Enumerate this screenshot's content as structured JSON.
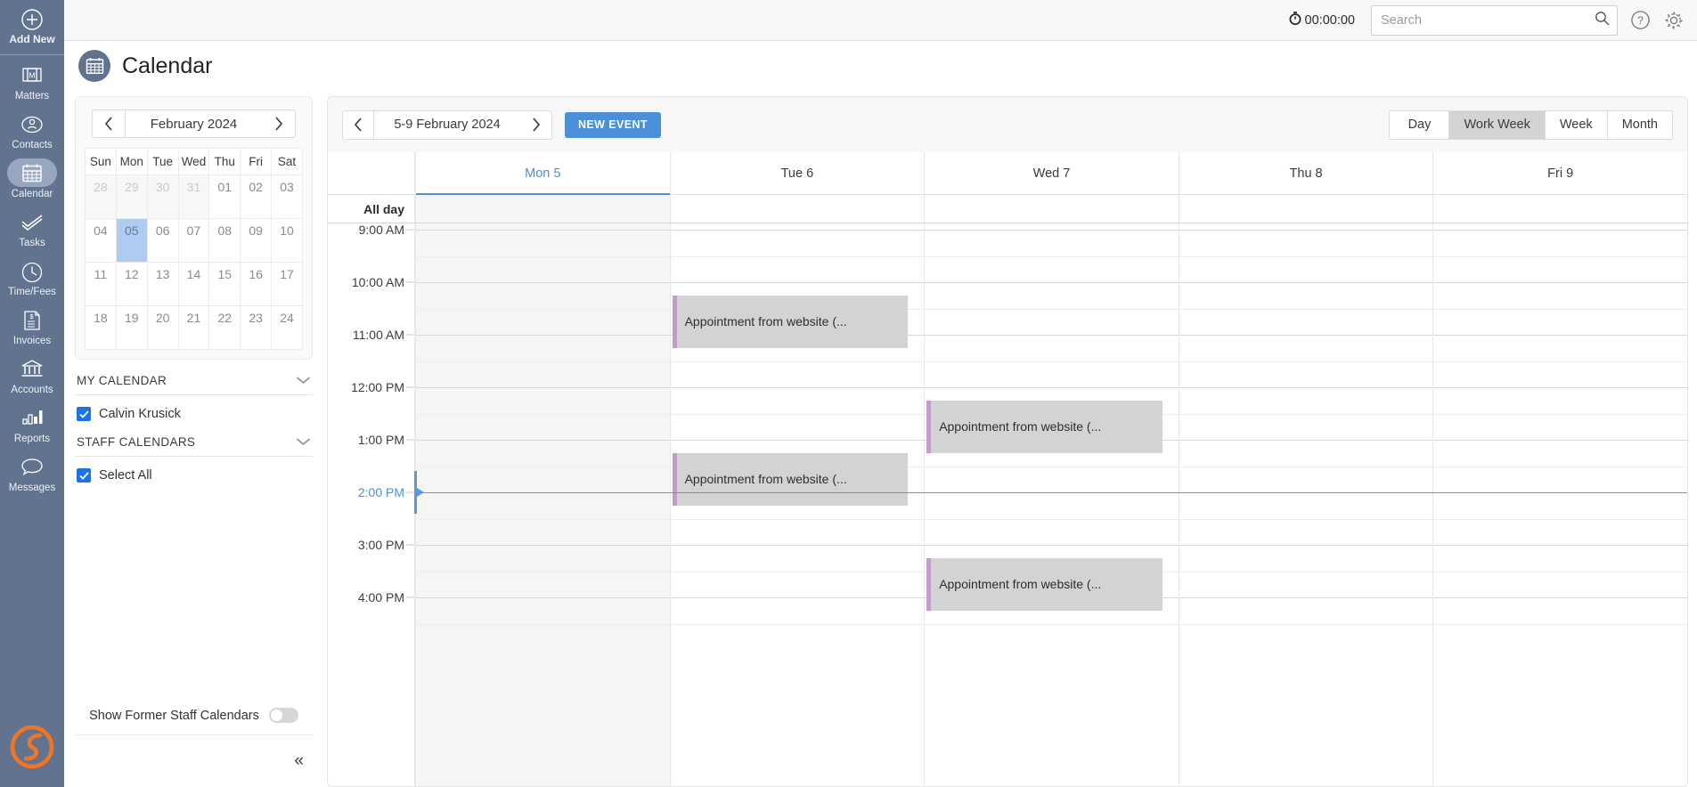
{
  "leftnav": {
    "add_new": {
      "label": "Add New",
      "icon": "plus-circle-icon"
    },
    "items": [
      {
        "label": "Matters",
        "icon": "matters-icon",
        "active": false
      },
      {
        "label": "Contacts",
        "icon": "contacts-icon",
        "active": false
      },
      {
        "label": "Calendar",
        "icon": "calendar-icon",
        "active": true
      },
      {
        "label": "Tasks",
        "icon": "tasks-icon",
        "active": false
      },
      {
        "label": "Time/Fees",
        "icon": "clock-icon",
        "active": false
      },
      {
        "label": "Invoices",
        "icon": "invoice-icon",
        "active": false
      },
      {
        "label": "Accounts",
        "icon": "bank-icon",
        "active": false
      },
      {
        "label": "Reports",
        "icon": "bar-chart-icon",
        "active": false
      },
      {
        "label": "Messages",
        "icon": "chat-icon",
        "active": false
      }
    ],
    "logo": "smokeball-s-logo",
    "bg_color": "#61738f",
    "active_pill_color": "#98a7bf",
    "logo_color": "#ef7622"
  },
  "topbar": {
    "timer_value": "00:00:00",
    "timer_icon": "stopwatch-icon",
    "search_placeholder": "Search",
    "search_value": "",
    "search_icon": "search-icon",
    "help_icon": "help-circle-icon",
    "settings_icon": "gear-icon"
  },
  "page": {
    "title": "Calendar",
    "icon": "calendar-badge-icon"
  },
  "minicalendar": {
    "prev_icon": "chevron-left-icon",
    "next_icon": "chevron-right-icon",
    "month_label": "February 2024",
    "weekdays": [
      "Sun",
      "Mon",
      "Tue",
      "Wed",
      "Thu",
      "Fri",
      "Sat"
    ],
    "weeks": [
      [
        {
          "d": "28",
          "out": true
        },
        {
          "d": "29",
          "out": true
        },
        {
          "d": "30",
          "out": true
        },
        {
          "d": "31",
          "out": true
        },
        {
          "d": "01",
          "out": false
        },
        {
          "d": "02",
          "out": false
        },
        {
          "d": "03",
          "out": false
        }
      ],
      [
        {
          "d": "04",
          "out": false
        },
        {
          "d": "05",
          "out": false,
          "selected": true
        },
        {
          "d": "06",
          "out": false
        },
        {
          "d": "07",
          "out": false
        },
        {
          "d": "08",
          "out": false
        },
        {
          "d": "09",
          "out": false
        },
        {
          "d": "10",
          "out": false
        }
      ],
      [
        {
          "d": "11",
          "out": false
        },
        {
          "d": "12",
          "out": false
        },
        {
          "d": "13",
          "out": false
        },
        {
          "d": "14",
          "out": false
        },
        {
          "d": "15",
          "out": false
        },
        {
          "d": "16",
          "out": false
        },
        {
          "d": "17",
          "out": false
        }
      ],
      [
        {
          "d": "18",
          "out": false
        },
        {
          "d": "19",
          "out": false
        },
        {
          "d": "20",
          "out": false
        },
        {
          "d": "21",
          "out": false
        },
        {
          "d": "22",
          "out": false
        },
        {
          "d": "23",
          "out": false
        },
        {
          "d": "24",
          "out": false
        }
      ]
    ],
    "selected_bg": "#aecbf2"
  },
  "calendar_list": {
    "my_calendar": {
      "header": "MY CALENDAR",
      "collapse_icon": "chevron-down-icon",
      "entries": [
        {
          "label": "Calvin Krusick",
          "checked": true
        }
      ]
    },
    "staff_calendars": {
      "header": "STAFF CALENDARS",
      "collapse_icon": "chevron-down-icon",
      "entries": [
        {
          "label": "Select All",
          "checked": true
        }
      ]
    },
    "former_toggle": {
      "label": "Show Former Staff Calendars",
      "on": false
    },
    "collapse_panel": {
      "icon": "double-chevron-left-icon",
      "glyph": "«"
    },
    "checkbox_color": "#1a73e8"
  },
  "toolbar": {
    "prev_icon": "chevron-left-icon",
    "next_icon": "chevron-right-icon",
    "range_label": "5-9 February 2024",
    "new_event_label": "NEW EVENT",
    "new_event_color": "#4a90d9",
    "views": [
      {
        "label": "Day",
        "active": false
      },
      {
        "label": "Work Week",
        "active": true
      },
      {
        "label": "Week",
        "active": false
      },
      {
        "label": "Month",
        "active": false
      }
    ]
  },
  "grid": {
    "all_day_label": "All day",
    "days": [
      {
        "label": "Mon 5",
        "today": true
      },
      {
        "label": "Tue 6",
        "today": false
      },
      {
        "label": "Wed 7",
        "today": false
      },
      {
        "label": "Thu 8",
        "today": false
      },
      {
        "label": "Fri 9",
        "today": false
      }
    ],
    "time_labels": [
      "9:00 AM",
      "10:00 AM",
      "11:00 AM",
      "12:00 PM",
      "1:00 PM",
      "2:00 PM",
      "3:00 PM",
      "4:00 PM"
    ],
    "current_time_label": "2:00 PM",
    "current_time_hour_index": 5,
    "events": [
      {
        "title": "Appointment from website (...",
        "day": 1,
        "start_hour_index": 1.25,
        "duration_hours": 1.0
      },
      {
        "title": "Appointment from website (...",
        "day": 2,
        "start_hour_index": 3.25,
        "duration_hours": 1.0
      },
      {
        "title": "Appointment from website (...",
        "day": 1,
        "start_hour_index": 4.25,
        "duration_hours": 1.0
      },
      {
        "title": "Appointment from website (...",
        "day": 2,
        "start_hour_index": 6.25,
        "duration_hours": 1.0
      }
    ],
    "event_bg": "#d3d3d3",
    "event_accent": "#c49ccb",
    "now_line_color": "#5b9bd5",
    "today_bg": "#f5f5f5"
  }
}
